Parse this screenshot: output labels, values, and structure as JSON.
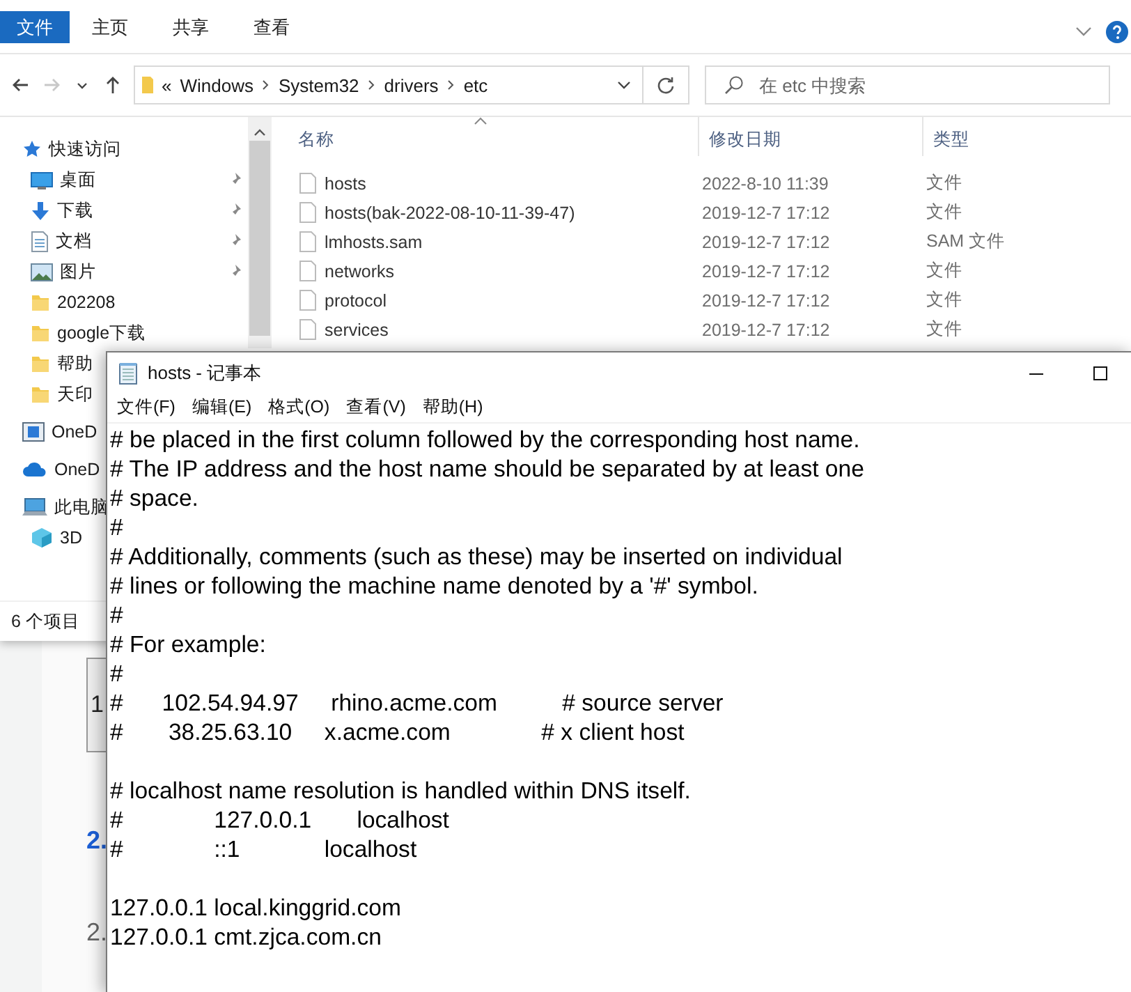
{
  "explorer": {
    "ribbon_tabs": [
      {
        "label": "文件",
        "selected": true
      },
      {
        "label": "主页",
        "selected": false
      },
      {
        "label": "共享",
        "selected": false
      },
      {
        "label": "查看",
        "selected": false
      }
    ],
    "nav_buttons": [
      {
        "kind": "back",
        "disabled": false
      },
      {
        "kind": "forward",
        "disabled": true
      },
      {
        "kind": "recent",
        "disabled": false
      },
      {
        "kind": "up",
        "disabled": false
      }
    ],
    "address": {
      "overflow": "«",
      "crumbs": [
        "Windows",
        "System32",
        "drivers",
        "etc"
      ]
    },
    "search": {
      "placeholder": "在 etc 中搜索"
    },
    "sidebar": [
      {
        "label": "快速访问",
        "kind": "star",
        "children": [
          {
            "label": "桌面",
            "kind": "desktop",
            "pinned": true
          },
          {
            "label": "下载",
            "kind": "download",
            "pinned": true
          },
          {
            "label": "文档",
            "kind": "document",
            "pinned": true
          },
          {
            "label": "图片",
            "kind": "picture",
            "pinned": true
          },
          {
            "label": "202208",
            "kind": "folder",
            "pinned": false
          },
          {
            "label": "google下载",
            "kind": "folder",
            "pinned": false
          },
          {
            "label": "帮助",
            "kind": "folder",
            "pinned": false
          },
          {
            "label": "天印",
            "kind": "folder",
            "pinned": false
          }
        ]
      },
      {
        "label": "OneD",
        "kind": "drive"
      },
      {
        "label": "OneD",
        "kind": "cloud"
      },
      {
        "label": "此电脑",
        "kind": "computer",
        "children": [
          {
            "label": "3D",
            "kind": "cube",
            "pinned": false
          }
        ]
      }
    ],
    "columns": [
      {
        "label": "名称",
        "sorted": true
      },
      {
        "label": "修改日期",
        "sorted": false
      },
      {
        "label": "类型",
        "sorted": false
      }
    ],
    "files": [
      {
        "name": "hosts",
        "modified": "2022-8-10 11:39",
        "type": "文件"
      },
      {
        "name": "hosts(bak-2022-08-10-11-39-47)",
        "modified": "2019-12-7 17:12",
        "type": "文件"
      },
      {
        "name": "lmhosts.sam",
        "modified": "2019-12-7 17:12",
        "type": "SAM 文件"
      },
      {
        "name": "networks",
        "modified": "2019-12-7 17:12",
        "type": "文件"
      },
      {
        "name": "protocol",
        "modified": "2019-12-7 17:12",
        "type": "文件"
      },
      {
        "name": "services",
        "modified": "2019-12-7 17:12",
        "type": "文件"
      }
    ],
    "status_bar": "6 个项目"
  },
  "background_document": {
    "items": [
      {
        "text": "1",
        "kind": "plain"
      },
      {
        "text": "2.",
        "kind": "heading"
      },
      {
        "text": "2.",
        "kind": "muted"
      }
    ]
  },
  "notepad": {
    "title": "hosts - 记事本",
    "menu": [
      "文件(F)",
      "编辑(E)",
      "格式(O)",
      "查看(V)",
      "帮助(H)"
    ],
    "blocks": [
      [
        "# be placed in the first column followed by the corresponding host name.",
        "# The IP address and the host name should be separated by at least one",
        "# space.",
        "#",
        "# Additionally, comments (such as these) may be inserted on individual",
        "# lines or following the machine name denoted by a '#' symbol.",
        "#",
        "# For example:",
        "#",
        "#      102.54.94.97     rhino.acme.com          # source server",
        "#       38.25.63.10     x.acme.com              # x client host"
      ],
      [
        "# localhost name resolution is handled within DNS itself.",
        "#              127.0.0.1       localhost",
        "#              ::1             localhost"
      ],
      [
        "127.0.0.1 local.kinggrid.com",
        "127.0.0.1 cmt.zjca.com.cn"
      ]
    ]
  }
}
